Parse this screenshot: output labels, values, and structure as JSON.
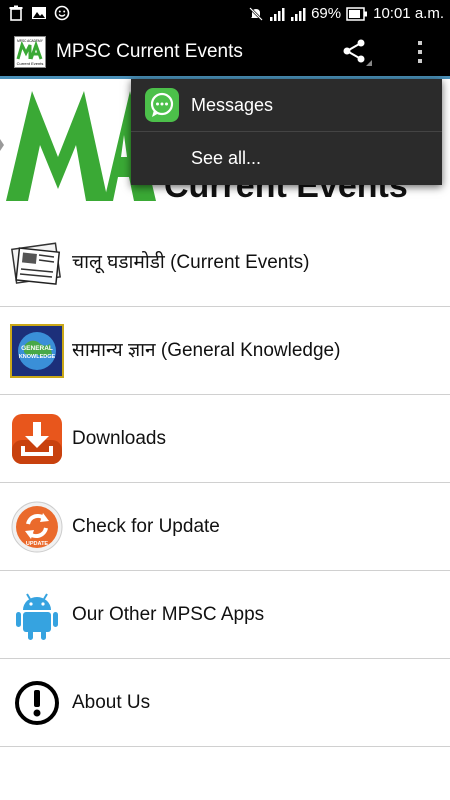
{
  "status_bar": {
    "battery": "69%",
    "time": "10:01 a.m."
  },
  "app_bar": {
    "logo_text_top": "MPSC ACADEMY",
    "logo_text_bottom": "Current Events",
    "title": "MPSC Current Events"
  },
  "banner": {
    "subtitle": "Current Events"
  },
  "menu_items": [
    {
      "label": "चालू घडामोडी (Current Events)",
      "icon": "newspaper-icon"
    },
    {
      "label": "सामान्य ज्ञान (General Knowledge)",
      "icon": "general-knowledge-icon"
    },
    {
      "label": "Downloads",
      "icon": "download-icon"
    },
    {
      "label": "Check for Update",
      "icon": "update-icon"
    },
    {
      "label": "Our Other MPSC Apps",
      "icon": "android-icon"
    },
    {
      "label": "About Us",
      "icon": "info-icon"
    }
  ],
  "icon_texts": {
    "gk_line1": "GENERAL",
    "gk_line2": "KNOWLEDGE",
    "update": "UPDATE"
  },
  "share_popup": {
    "items": [
      {
        "label": "Messages",
        "icon": "messages-icon"
      },
      {
        "label": "See all...",
        "icon": ""
      }
    ]
  },
  "colors": {
    "accent_line": "#4a90b8",
    "logo_green": "#3aa935",
    "download_orange": "#e8561c",
    "android_blue": "#36a3e0",
    "messages_green": "#4cc04a"
  }
}
